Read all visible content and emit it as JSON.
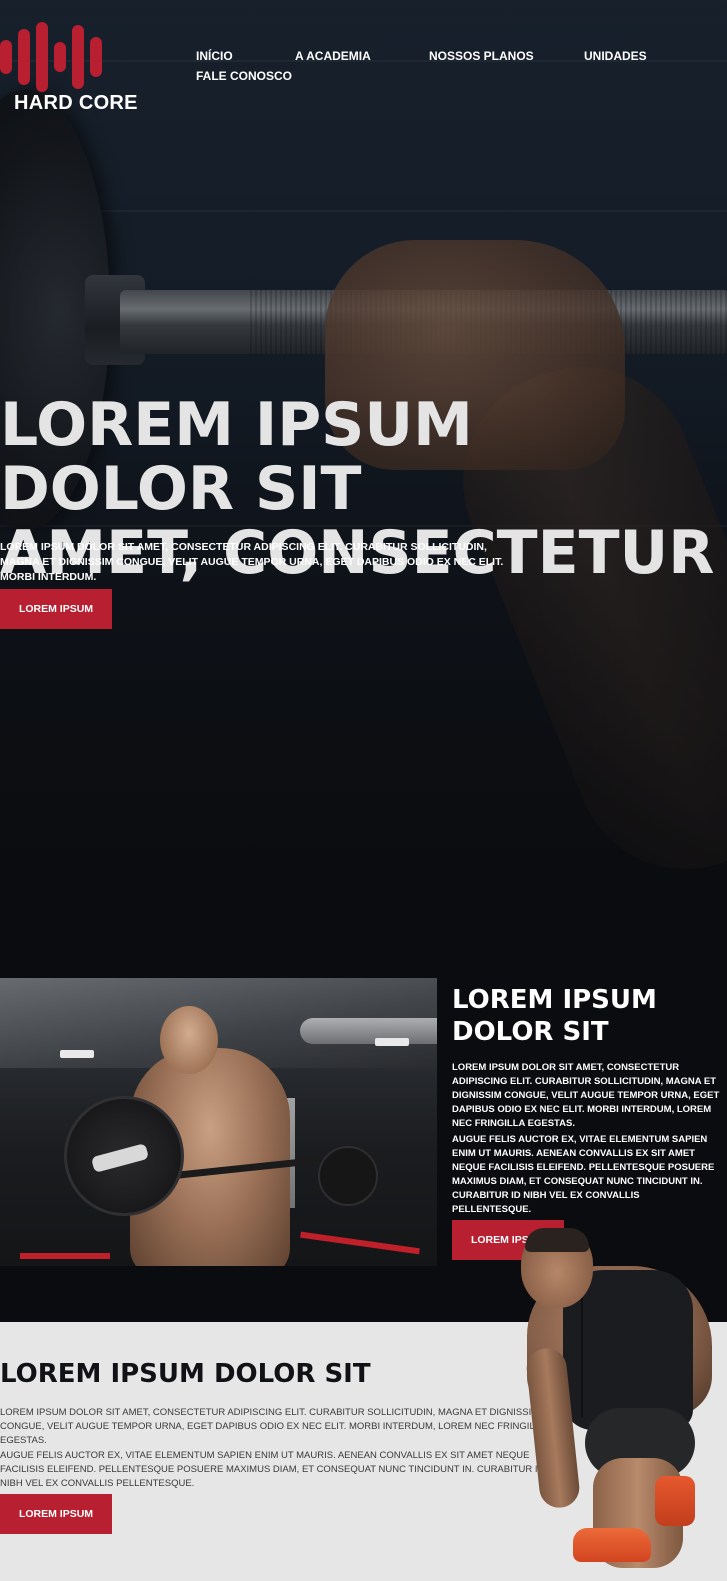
{
  "brand": {
    "name": "HARD CORE",
    "accent": "#b81f30"
  },
  "nav": {
    "items": [
      "INÍCIO",
      "A ACADEMIA",
      "NOSSOS PLANOS",
      "UNIDADES",
      "FALE CONOSCO"
    ]
  },
  "hero": {
    "title_line1": "LOREM IPSUM DOLOR SIT",
    "title_line2": "AMET, CONSECTETUR",
    "text": "LOREM IPSUM DOLOR SIT AMET, CONSECTETUR ADIPISCING ELIT. CURABITUR SOLLICITUDIN, MAGNA ET DIGNISSIM CONGUE, VELIT AUGUE TEMPOR URNA, EGET DAPIBUS ODIO EX NEC ELIT. MORBI INTERDUM.",
    "button": "LOREM IPSUM"
  },
  "about": {
    "title": "LOREM IPSUM DOLOR SIT",
    "p1": "LOREM IPSUM DOLOR SIT AMET, CONSECTETUR ADIPISCING ELIT. CURABITUR SOLLICITUDIN, MAGNA ET DIGNISSIM CONGUE, VELIT AUGUE TEMPOR URNA, EGET DAPIBUS ODIO EX NEC ELIT. MORBI INTERDUM, LOREM NEC FRINGILLA EGESTAS.",
    "p2": "AUGUE FELIS AUCTOR EX, VITAE ELEMENTUM SAPIEN ENIM UT MAURIS. AENEAN CONVALLIS EX SIT AMET NEQUE FACILISIS ELEIFEND. PELLENTESQUE POSUERE MAXIMUS DIAM, ET CONSEQUAT NUNC TINCIDUNT IN. CURABITUR ID NIBH VEL EX CONVALLIS PELLENTESQUE.",
    "button": "LOREM IPSUM"
  },
  "plans": {
    "title": "LOREM IPSUM DOLOR SIT",
    "p1": "LOREM IPSUM DOLOR SIT AMET, CONSECTETUR ADIPISCING ELIT. CURABITUR SOLLICITUDIN, MAGNA ET DIGNISSIM CONGUE, VELIT AUGUE TEMPOR URNA, EGET DAPIBUS ODIO EX NEC ELIT. MORBI INTERDUM, LOREM NEC FRINGILLA EGESTAS.",
    "p2": "AUGUE FELIS AUCTOR EX, VITAE ELEMENTUM SAPIEN ENIM UT MAURIS. AENEAN CONVALLIS EX SIT AMET NEQUE FACILISIS ELEIFEND. PELLENTESQUE POSUERE MAXIMUS DIAM, ET CONSEQUAT NUNC TINCIDUNT IN. CURABITUR ID NIBH VEL EX CONVALLIS PELLENTESQUE.",
    "button": "LOREM IPSUM"
  },
  "colors": {
    "hero_bg": "#141c26",
    "dark_bg": "#0b0c0f",
    "light_bg": "#e6e6e6",
    "button": "#b81f30"
  }
}
